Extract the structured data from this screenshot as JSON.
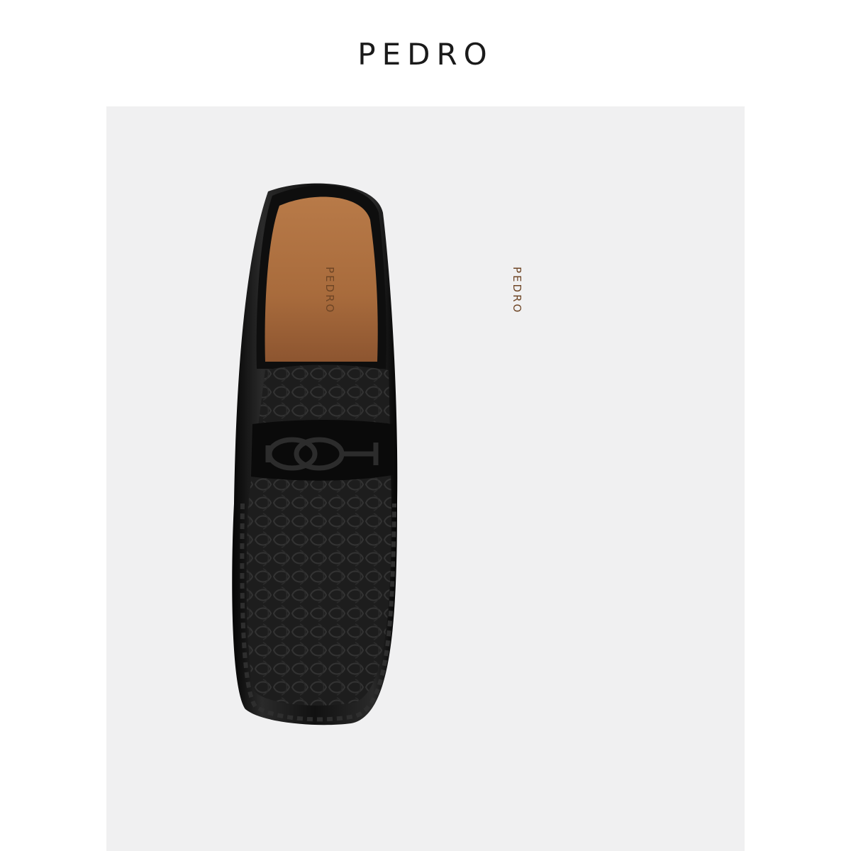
{
  "header": {
    "brand": "PEDRO"
  },
  "product": {
    "insole_brand_left": "PEDRO",
    "insole_brand_right": "PEDRO"
  },
  "colors": {
    "background": "#ffffff",
    "photo_bg": "#f0f0f1",
    "leather": "#141414",
    "insole": "#a86b3c",
    "fabric": "#232323"
  },
  "icons": [
    "shoe-left",
    "shoe-right",
    "buckle-icon"
  ]
}
